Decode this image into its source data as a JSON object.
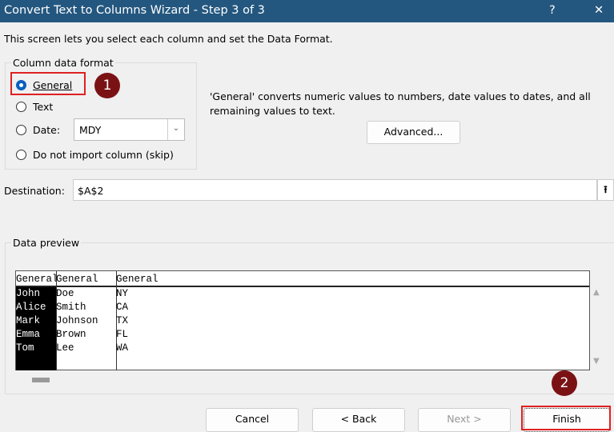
{
  "window": {
    "title": "Convert Text to Columns Wizard - Step 3 of 3",
    "help": "?",
    "close": "✕"
  },
  "description": "This screen lets you select each column and set the Data Format.",
  "column_format": {
    "legend": "Column data format",
    "options": [
      {
        "label": "General",
        "selected": true
      },
      {
        "label": "Text",
        "selected": false
      },
      {
        "label": "Date:",
        "selected": false
      },
      {
        "label": "Do not import column (skip)",
        "selected": false
      }
    ],
    "date_value": "MDY"
  },
  "info": {
    "line1": "'General' converts numeric values to numbers, date values to dates, and all",
    "line2": "remaining values to text."
  },
  "advanced_label": "Advanced...",
  "destination": {
    "label": "Destination:",
    "value": "$A$2"
  },
  "preview": {
    "legend": "Data preview",
    "headers": [
      "General",
      "General",
      "General"
    ],
    "rows": [
      [
        "John",
        "Doe",
        "NY"
      ],
      [
        "Alice",
        "Smith",
        "CA"
      ],
      [
        "Mark",
        "Johnson",
        "TX"
      ],
      [
        "Emma",
        "Brown",
        "FL"
      ],
      [
        "Tom",
        "Lee",
        "WA"
      ]
    ]
  },
  "buttons": {
    "cancel": "Cancel",
    "back": "< Back",
    "next": "Next >",
    "finish": "Finish"
  },
  "annotations": {
    "one": "1",
    "two": "2"
  },
  "colors": {
    "titlebar": "#24577f",
    "highlight": "#e02020",
    "badge": "#7a1214"
  }
}
